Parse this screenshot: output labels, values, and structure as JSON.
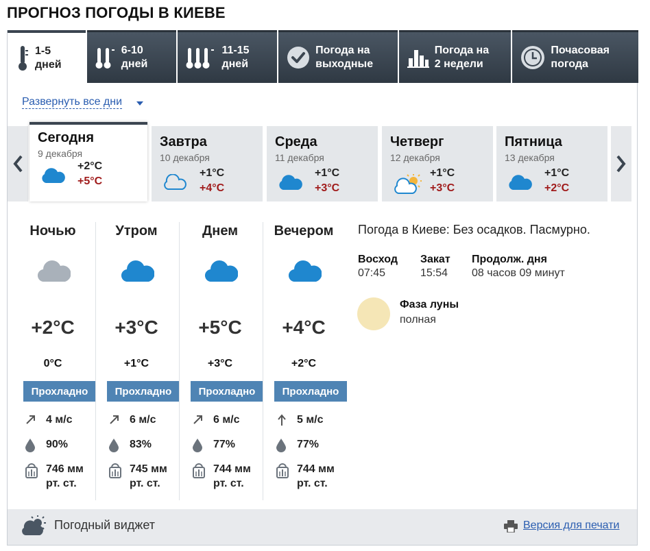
{
  "title": "ПРОГНОЗ ПОГОДЫ В КИЕВЕ",
  "tabs": [
    {
      "label": "1-5\nдней",
      "icon": "thermometer-icon",
      "active": true
    },
    {
      "label": "6-10\nдней",
      "icon": "two-thermometers-icon",
      "active": false
    },
    {
      "label": "11-15\nдней",
      "icon": "three-thermometers-icon",
      "active": false
    },
    {
      "label": "Погода на\nвыходные",
      "icon": "checkmark-circle-icon",
      "active": false
    },
    {
      "label": "Погода на\n2 недели",
      "icon": "bar-chart-icon",
      "active": false
    },
    {
      "label": "Почасовая\nпогода",
      "icon": "clock-icon",
      "active": false
    }
  ],
  "expand_label": "Развернуть все дни",
  "days": [
    {
      "name": "Сегодня",
      "date": "9 декабря",
      "tmin": "+2°C",
      "tmax": "+5°C",
      "icon": "cloud-icon",
      "active": true
    },
    {
      "name": "Завтра",
      "date": "10 декабря",
      "tmin": "+1°C",
      "tmax": "+4°C",
      "icon": "cloud-outline-icon",
      "active": false
    },
    {
      "name": "Среда",
      "date": "11 декабря",
      "tmin": "+1°C",
      "tmax": "+3°C",
      "icon": "cloud-icon",
      "active": false
    },
    {
      "name": "Четверг",
      "date": "12 декабря",
      "tmin": "+1°C",
      "tmax": "+3°C",
      "icon": "sun-cloud-icon",
      "active": false
    },
    {
      "name": "Пятница",
      "date": "13 декабря",
      "tmin": "+1°C",
      "tmax": "+2°C",
      "icon": "cloud-icon",
      "active": false
    }
  ],
  "periods": [
    {
      "name": "Ночью",
      "temp": "+2°C",
      "feel": "0°C",
      "badge": "Прохладно",
      "wind": "4 м/с",
      "wind_dir": "northeast",
      "humidity": "90%",
      "pressure": "746 мм\nрт. ст.",
      "icon": "cloud-night-icon"
    },
    {
      "name": "Утром",
      "temp": "+3°C",
      "feel": "+1°C",
      "badge": "Прохладно",
      "wind": "6 м/с",
      "wind_dir": "northeast",
      "humidity": "83%",
      "pressure": "745 мм\nрт. ст.",
      "icon": "cloud-icon"
    },
    {
      "name": "Днем",
      "temp": "+5°C",
      "feel": "+3°C",
      "badge": "Прохладно",
      "wind": "6 м/с",
      "wind_dir": "northeast",
      "humidity": "77%",
      "pressure": "744 мм\nрт. ст.",
      "icon": "cloud-icon"
    },
    {
      "name": "Вечером",
      "temp": "+4°C",
      "feel": "+2°C",
      "badge": "Прохладно",
      "wind": "5 м/с",
      "wind_dir": "north",
      "humidity": "77%",
      "pressure": "744 мм\nрт. ст.",
      "icon": "cloud-icon"
    }
  ],
  "info": {
    "summary": "Погода в Киеве: Без осадков. Пасмурно.",
    "sunrise_label": "Восход",
    "sunrise": "07:45",
    "sunset_label": "Закат",
    "sunset": "15:54",
    "daylength_label": "Продолж. дня",
    "daylength": "08 часов 09 минут",
    "moon_label": "Фаза луны",
    "moon_phase": "полная"
  },
  "footer": {
    "widget_label": "Погодный виджет",
    "print_label": "Версия для печати"
  },
  "colors": {
    "tab_dark": "#3b4550",
    "cloud_blue": "#1f87cf",
    "cloud_grey": "#a9b1ba",
    "badge": "#4f84b4",
    "temp_max": "#a01b1b",
    "link": "#2a5db0",
    "moon": "#f5e6b6"
  }
}
